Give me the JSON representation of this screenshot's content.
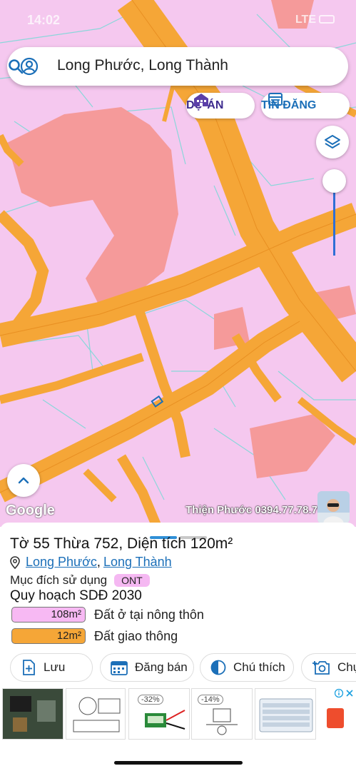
{
  "status": {
    "time": "14:02",
    "carrier": "LTE"
  },
  "search": {
    "query": "Long Phước, Long Thành"
  },
  "pills": {
    "du_an": "DỰ ÁN",
    "tin_dang": "TIN ĐĂNG"
  },
  "map": {
    "google_label": "Google",
    "watermark": "Thiện Phước 0394.77.78.79"
  },
  "panel": {
    "title": "Tờ 55 Thừa 752, Diện tích 120m²",
    "location": {
      "ward": "Long Phước",
      "separator": ",",
      "district": "Long Thành"
    },
    "purpose_label": "Mục đích sử dụng",
    "purpose_code": "ONT",
    "plan_title": "Quy hoạch SDĐ 2030",
    "legend": [
      {
        "area": "108m²",
        "label": "Đất ở tại nông thôn",
        "color": "#f7b9f3"
      },
      {
        "area": "12m²",
        "label": "Đất giao thông",
        "color": "#f5a637"
      }
    ],
    "actions": {
      "save": "Lưu",
      "sell": "Đăng bán",
      "legend": "Chú thích",
      "capture": "Chụ"
    }
  },
  "ad": {
    "discount_1": "-32%",
    "discount_2": "-14%"
  },
  "colors": {
    "land": "#f5c8ef",
    "road": "#f5a637",
    "parcel": "#f59a9a",
    "accent": "#1b6fb8"
  }
}
